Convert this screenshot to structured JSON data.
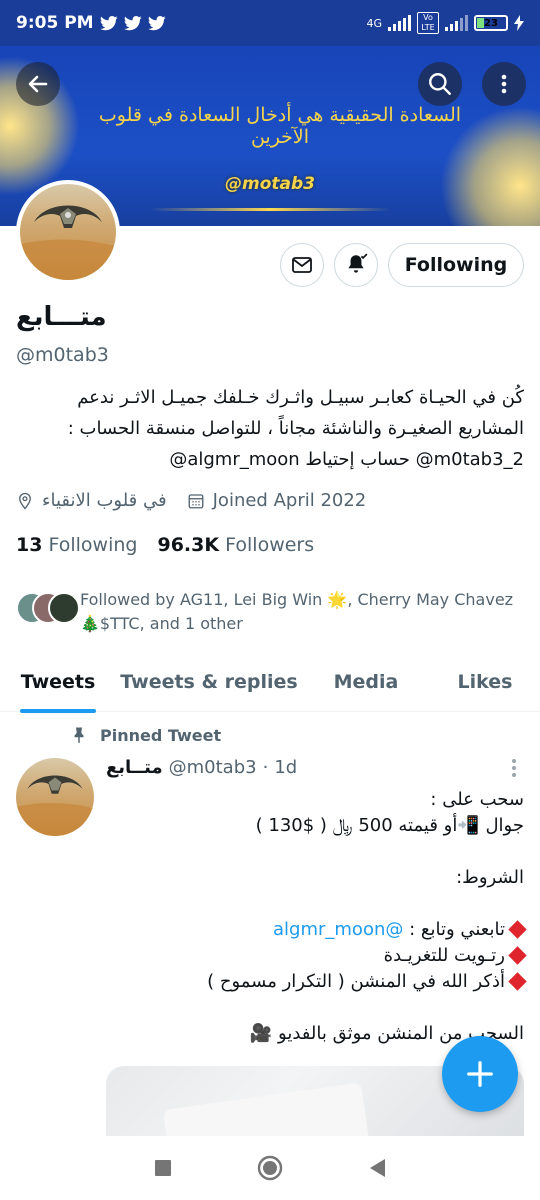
{
  "status_bar": {
    "time": "9:05 PM",
    "network_label": "4G",
    "volte_label": "Vo LTE",
    "battery_level": "23",
    "notification_icons": [
      "twitter-icon",
      "twitter-icon",
      "twitter-icon"
    ]
  },
  "banner": {
    "quote": "السعادة الحقيقية هي أدخال السعادة في قلوب الآخرين",
    "handle_art": "@motab3"
  },
  "profile": {
    "display_name": "متـــابع",
    "handle": "@m0tab3",
    "bio_lines": [
      "كُن في الحيـاة كعابـر سبيـل واثـرك خـلفك جميـل الاثـر ندعم",
      "المشاريع الصغيـرة والناشئة مجاناً ، للتواصل منسقة الحساب :",
      "m0tab3_2@ حساب إحتياط algmr_moon@"
    ],
    "location": "في قلوب الانقياء",
    "joined": "Joined April 2022",
    "following_count": "13",
    "following_label": "Following",
    "followers_count": "96.3K",
    "followers_label": "Followers",
    "followed_by_line1": "Followed by AG11, Lei Big Win 🌟, Cherry May Chavez",
    "followed_by_line2": "🎄$TTC, and 1 other"
  },
  "actions": {
    "following_button": "Following"
  },
  "tabs": [
    {
      "label": "Tweets",
      "active": true
    },
    {
      "label": "Tweets & replies",
      "active": false
    },
    {
      "label": "Media",
      "active": false
    },
    {
      "label": "Likes",
      "active": false
    }
  ],
  "pinned_tweet": {
    "pinned_label": "Pinned Tweet",
    "author_name": "متــابع",
    "author_handle": "@m0tab3",
    "time_sep": "·",
    "time": "1d",
    "line1": "سحب على :",
    "line2": "جوال 📲أو قيمته 500 ﷼ ( $130 )",
    "line3": "الشروط:",
    "line4_text": "تابعني وتابع : ",
    "line4_mention": "@algmr_moon",
    "line5": "رتـويت للتغريـدة",
    "line6": "أذكر الله في المنشن ( التكرار مسموح )",
    "line7": "السحب من المنشن موثق بالفديو 🎥"
  },
  "colors": {
    "accent": "#1d9bf0",
    "banner_blue": "#1c4fc6",
    "banner_gold": "#f7d44a",
    "diamond_red": "#e0242d"
  }
}
